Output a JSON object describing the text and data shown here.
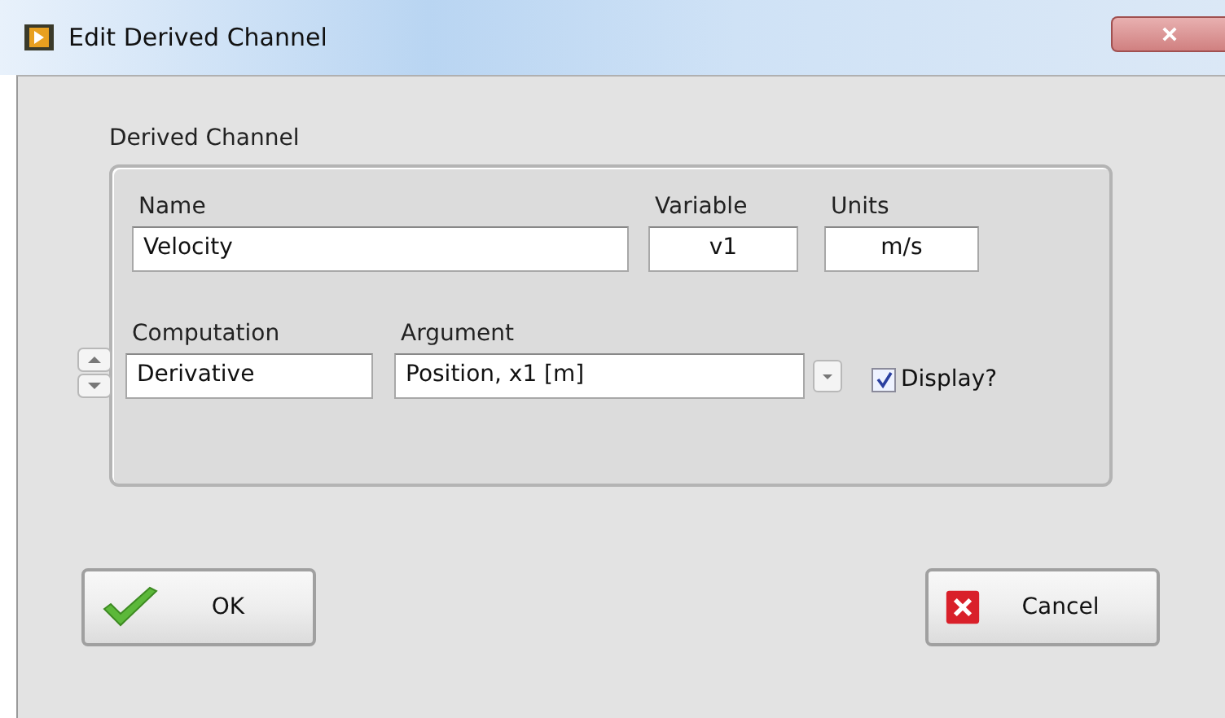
{
  "window": {
    "title": "Edit Derived Channel"
  },
  "group": {
    "label": "Derived Channel"
  },
  "fields": {
    "name": {
      "label": "Name",
      "value": "Velocity"
    },
    "variable": {
      "label": "Variable",
      "value": "v1"
    },
    "units": {
      "label": "Units",
      "value": "m/s"
    },
    "computation": {
      "label": "Computation",
      "value": "Derivative"
    },
    "argument": {
      "label": "Argument",
      "value": "Position, x1 [m]"
    }
  },
  "display": {
    "label": "Display?",
    "checked": true
  },
  "buttons": [
    {
      "kind": "ok",
      "label": "OK"
    },
    {
      "kind": "cancel",
      "label": "Cancel"
    }
  ]
}
